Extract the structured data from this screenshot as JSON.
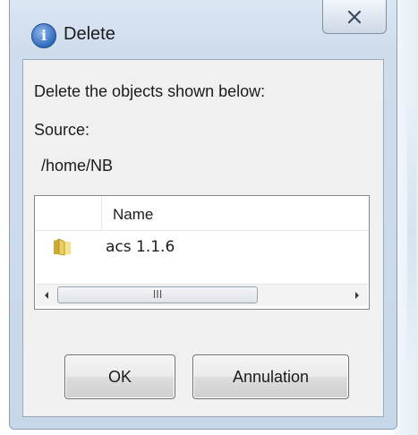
{
  "window": {
    "title": "Delete",
    "close_glyph": "✕"
  },
  "dialog": {
    "prompt": "Delete the objects shown below:",
    "source_label": "Source:",
    "source_path": "/home/NB"
  },
  "list": {
    "columns": [
      "Name"
    ],
    "rows": [
      {
        "name": "acs 1.1.6",
        "icon": "folder-icon"
      }
    ],
    "scroll_thumb_glyph": "III"
  },
  "buttons": {
    "ok_label": "OK",
    "cancel_label": "Annulation"
  },
  "colors": {
    "frame": "#cfdcec",
    "client": "#f0f0f0",
    "title_icon": "#2e6bbf"
  }
}
